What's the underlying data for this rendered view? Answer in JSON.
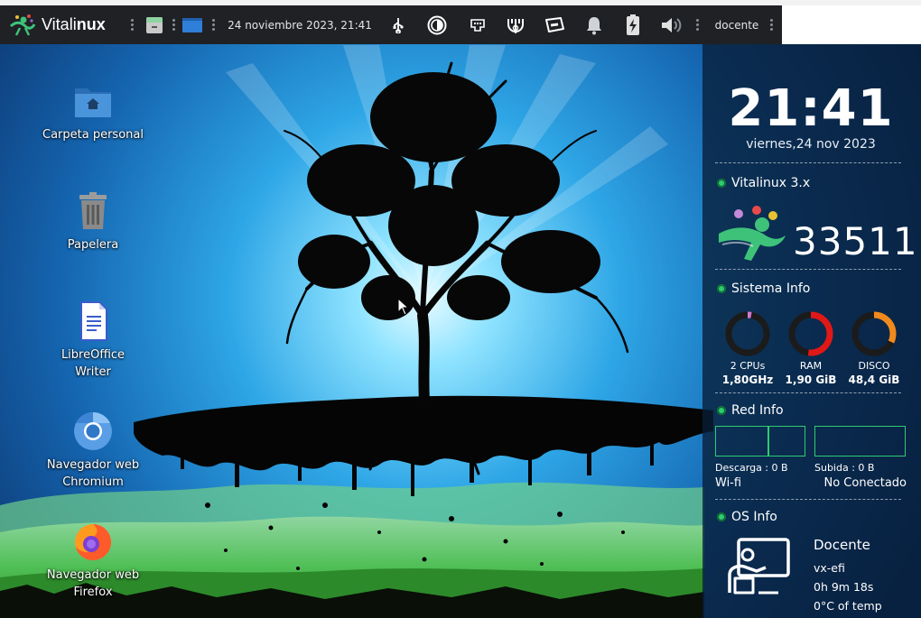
{
  "panel": {
    "brand_light": "Vitali",
    "brand_bold": "nux",
    "datetime": "24 noviembre 2023, 21:41",
    "user": "docente",
    "tray_icons": [
      "usb-icon",
      "display-icon",
      "network-icon",
      "vpn-icon",
      "keyboard-icon",
      "bell-icon",
      "battery-icon",
      "volume-icon"
    ]
  },
  "desktop": {
    "icons": [
      {
        "label": "Carpeta personal",
        "icon": "home-folder-icon"
      },
      {
        "label": "Papelera",
        "icon": "trash-icon"
      },
      {
        "label": "LibreOffice Writer",
        "icon": "writer-icon"
      },
      {
        "label": "Navegador web Chromium",
        "icon": "chromium-icon"
      },
      {
        "label": "Navegador web Firefox",
        "icon": "firefox-icon"
      }
    ]
  },
  "conky": {
    "clock": {
      "time": "21:41",
      "date": "viernes,24 nov 2023"
    },
    "vitalinux": {
      "title": "Vitalinux 3.x",
      "number": "33511"
    },
    "system": {
      "title": "Sistema Info",
      "gauges": [
        {
          "label": "2 CPUs",
          "value": "1,80GHz",
          "percent": 3,
          "color": "#d07ad0"
        },
        {
          "label": "RAM",
          "value": "1,90 GiB",
          "percent": 52,
          "color": "#e01818"
        },
        {
          "label": "DISCO",
          "value": "48,4 GiB",
          "percent": 32,
          "color": "#f08a1c"
        }
      ]
    },
    "network": {
      "title": "Red Info",
      "download": "Descarga : 0 B",
      "upload": "Subida : 0 B",
      "interface": "Wi-fi",
      "status": "No Conectado"
    },
    "os": {
      "title": "OS Info",
      "user": "Docente",
      "host": "vx-efi",
      "uptime": "0h 9m 18s",
      "temp": "0°C of temp"
    }
  },
  "colors": {
    "panel_bg": "#1f2125",
    "accent_green": "#2ecc71",
    "brand_green": "#3ec27a"
  }
}
